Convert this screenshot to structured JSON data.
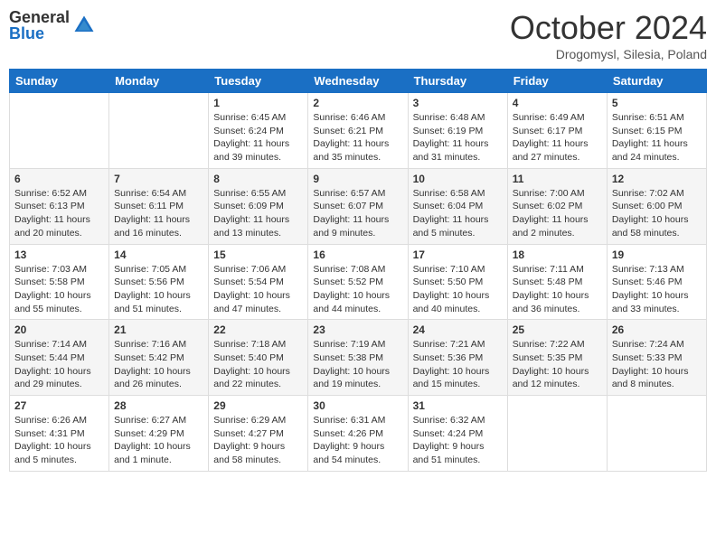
{
  "header": {
    "logo": {
      "general": "General",
      "blue": "Blue"
    },
    "title": "October 2024",
    "location": "Drogomysl, Silesia, Poland"
  },
  "days_of_week": [
    "Sunday",
    "Monday",
    "Tuesday",
    "Wednesday",
    "Thursday",
    "Friday",
    "Saturday"
  ],
  "weeks": [
    [
      {
        "day": "",
        "info": ""
      },
      {
        "day": "",
        "info": ""
      },
      {
        "day": "1",
        "info": "Sunrise: 6:45 AM\nSunset: 6:24 PM\nDaylight: 11 hours and 39 minutes."
      },
      {
        "day": "2",
        "info": "Sunrise: 6:46 AM\nSunset: 6:21 PM\nDaylight: 11 hours and 35 minutes."
      },
      {
        "day": "3",
        "info": "Sunrise: 6:48 AM\nSunset: 6:19 PM\nDaylight: 11 hours and 31 minutes."
      },
      {
        "day": "4",
        "info": "Sunrise: 6:49 AM\nSunset: 6:17 PM\nDaylight: 11 hours and 27 minutes."
      },
      {
        "day": "5",
        "info": "Sunrise: 6:51 AM\nSunset: 6:15 PM\nDaylight: 11 hours and 24 minutes."
      }
    ],
    [
      {
        "day": "6",
        "info": "Sunrise: 6:52 AM\nSunset: 6:13 PM\nDaylight: 11 hours and 20 minutes."
      },
      {
        "day": "7",
        "info": "Sunrise: 6:54 AM\nSunset: 6:11 PM\nDaylight: 11 hours and 16 minutes."
      },
      {
        "day": "8",
        "info": "Sunrise: 6:55 AM\nSunset: 6:09 PM\nDaylight: 11 hours and 13 minutes."
      },
      {
        "day": "9",
        "info": "Sunrise: 6:57 AM\nSunset: 6:07 PM\nDaylight: 11 hours and 9 minutes."
      },
      {
        "day": "10",
        "info": "Sunrise: 6:58 AM\nSunset: 6:04 PM\nDaylight: 11 hours and 5 minutes."
      },
      {
        "day": "11",
        "info": "Sunrise: 7:00 AM\nSunset: 6:02 PM\nDaylight: 11 hours and 2 minutes."
      },
      {
        "day": "12",
        "info": "Sunrise: 7:02 AM\nSunset: 6:00 PM\nDaylight: 10 hours and 58 minutes."
      }
    ],
    [
      {
        "day": "13",
        "info": "Sunrise: 7:03 AM\nSunset: 5:58 PM\nDaylight: 10 hours and 55 minutes."
      },
      {
        "day": "14",
        "info": "Sunrise: 7:05 AM\nSunset: 5:56 PM\nDaylight: 10 hours and 51 minutes."
      },
      {
        "day": "15",
        "info": "Sunrise: 7:06 AM\nSunset: 5:54 PM\nDaylight: 10 hours and 47 minutes."
      },
      {
        "day": "16",
        "info": "Sunrise: 7:08 AM\nSunset: 5:52 PM\nDaylight: 10 hours and 44 minutes."
      },
      {
        "day": "17",
        "info": "Sunrise: 7:10 AM\nSunset: 5:50 PM\nDaylight: 10 hours and 40 minutes."
      },
      {
        "day": "18",
        "info": "Sunrise: 7:11 AM\nSunset: 5:48 PM\nDaylight: 10 hours and 36 minutes."
      },
      {
        "day": "19",
        "info": "Sunrise: 7:13 AM\nSunset: 5:46 PM\nDaylight: 10 hours and 33 minutes."
      }
    ],
    [
      {
        "day": "20",
        "info": "Sunrise: 7:14 AM\nSunset: 5:44 PM\nDaylight: 10 hours and 29 minutes."
      },
      {
        "day": "21",
        "info": "Sunrise: 7:16 AM\nSunset: 5:42 PM\nDaylight: 10 hours and 26 minutes."
      },
      {
        "day": "22",
        "info": "Sunrise: 7:18 AM\nSunset: 5:40 PM\nDaylight: 10 hours and 22 minutes."
      },
      {
        "day": "23",
        "info": "Sunrise: 7:19 AM\nSunset: 5:38 PM\nDaylight: 10 hours and 19 minutes."
      },
      {
        "day": "24",
        "info": "Sunrise: 7:21 AM\nSunset: 5:36 PM\nDaylight: 10 hours and 15 minutes."
      },
      {
        "day": "25",
        "info": "Sunrise: 7:22 AM\nSunset: 5:35 PM\nDaylight: 10 hours and 12 minutes."
      },
      {
        "day": "26",
        "info": "Sunrise: 7:24 AM\nSunset: 5:33 PM\nDaylight: 10 hours and 8 minutes."
      }
    ],
    [
      {
        "day": "27",
        "info": "Sunrise: 6:26 AM\nSunset: 4:31 PM\nDaylight: 10 hours and 5 minutes."
      },
      {
        "day": "28",
        "info": "Sunrise: 6:27 AM\nSunset: 4:29 PM\nDaylight: 10 hours and 1 minute."
      },
      {
        "day": "29",
        "info": "Sunrise: 6:29 AM\nSunset: 4:27 PM\nDaylight: 9 hours and 58 minutes."
      },
      {
        "day": "30",
        "info": "Sunrise: 6:31 AM\nSunset: 4:26 PM\nDaylight: 9 hours and 54 minutes."
      },
      {
        "day": "31",
        "info": "Sunrise: 6:32 AM\nSunset: 4:24 PM\nDaylight: 9 hours and 51 minutes."
      },
      {
        "day": "",
        "info": ""
      },
      {
        "day": "",
        "info": ""
      }
    ]
  ]
}
